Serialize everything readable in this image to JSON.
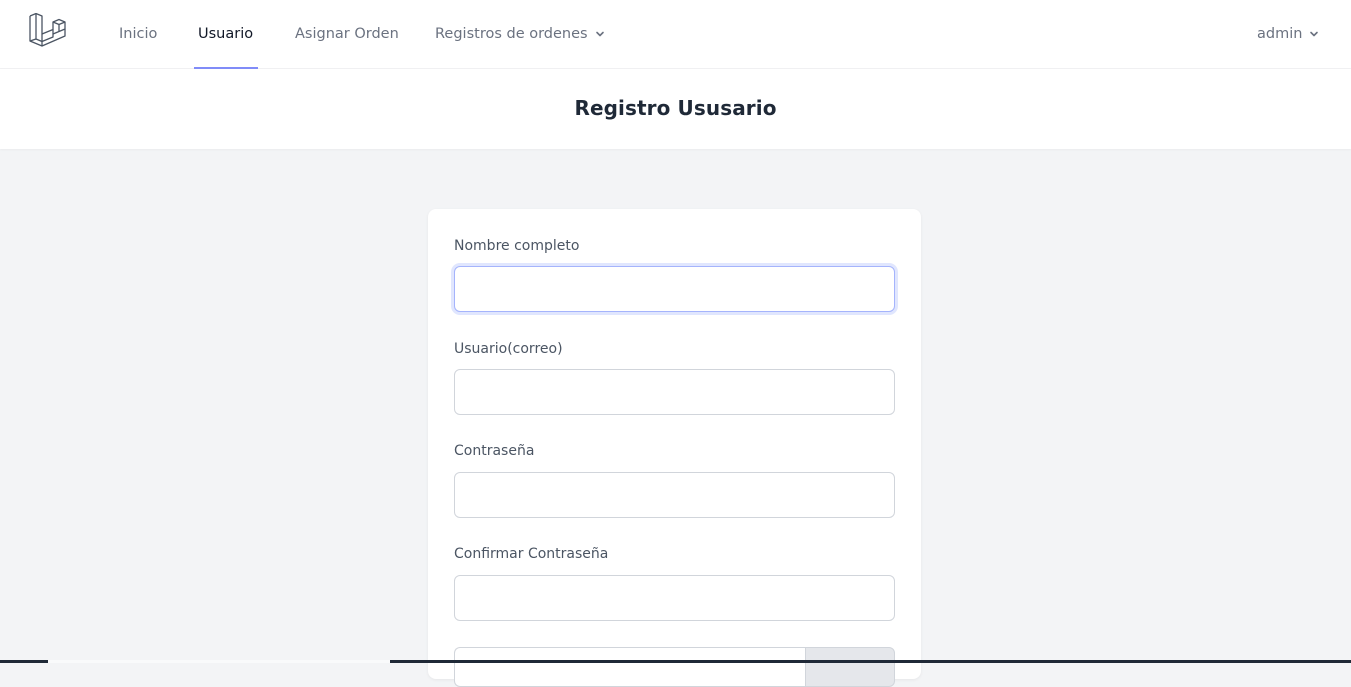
{
  "nav": {
    "links": [
      {
        "label": "Inicio",
        "active": false
      },
      {
        "label": "Usuario",
        "active": true
      },
      {
        "label": "Asignar Orden",
        "active": false
      },
      {
        "label": "Registros de ordenes",
        "active": false,
        "dropdown": true
      }
    ],
    "user_label": "admin",
    "accent_color": "#818cf8",
    "logo_icon": "laravel-logo-icon"
  },
  "header": {
    "title": "Registro Ususario"
  },
  "form": {
    "fields": [
      {
        "label": "Nombre completo",
        "value": "",
        "focused": true
      },
      {
        "label": "Usuario(correo)",
        "value": ""
      },
      {
        "label": "Contraseña",
        "value": ""
      },
      {
        "label": "Confirmar Contraseña",
        "value": ""
      }
    ]
  }
}
